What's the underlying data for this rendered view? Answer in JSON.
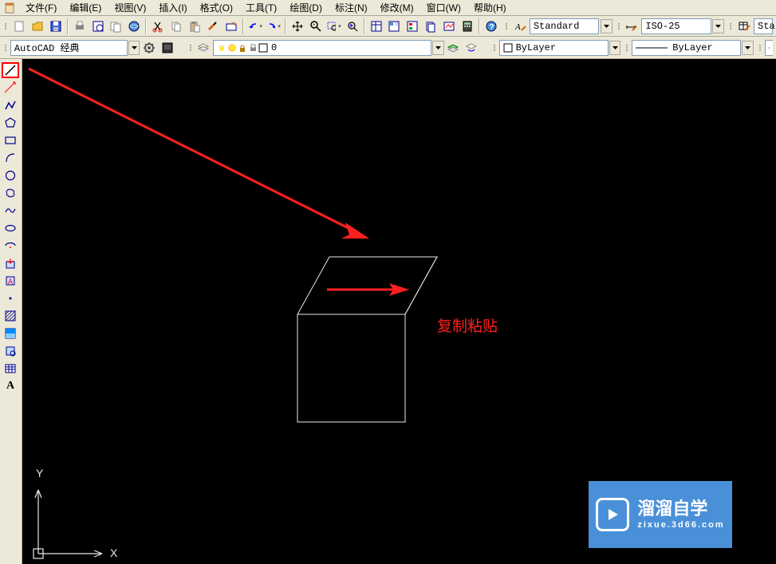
{
  "menu": {
    "items": [
      {
        "label": "文件(F)",
        "key": "F"
      },
      {
        "label": "编辑(E)",
        "key": "E"
      },
      {
        "label": "视图(V)",
        "key": "V"
      },
      {
        "label": "插入(I)",
        "key": "I"
      },
      {
        "label": "格式(O)",
        "key": "O"
      },
      {
        "label": "工具(T)",
        "key": "T"
      },
      {
        "label": "绘图(D)",
        "key": "D"
      },
      {
        "label": "标注(N)",
        "key": "N"
      },
      {
        "label": "修改(M)",
        "key": "M"
      },
      {
        "label": "窗口(W)",
        "key": "W"
      },
      {
        "label": "帮助(H)",
        "key": "H"
      }
    ]
  },
  "toolbar1": {
    "text_style": "Standard",
    "dim_style": "ISO-25",
    "table_style_abbrev": "Sta"
  },
  "toolbar2": {
    "workspace": "AutoCAD 经典",
    "layer_current": "0",
    "properties_color": "ByLayer",
    "linetype": "ByLayer"
  },
  "canvas": {
    "annotation_text": "复制粘贴",
    "axis_y": "Y",
    "axis_x": "X"
  },
  "watermark": {
    "brand": "溜溜自学",
    "url": "zixue.3d66.com"
  },
  "colors": {
    "accent_red": "#ff0000",
    "canvas_bg": "#000000",
    "ui_bg": "#ece9d8",
    "watermark_bg": "#4a90d9"
  },
  "left_tools": [
    "line-tool",
    "construction-line-tool",
    "polyline-tool",
    "polygon-tool",
    "rectangle-tool",
    "arc-tool",
    "circle-tool",
    "revision-cloud-tool",
    "spline-tool",
    "ellipse-tool",
    "ellipse-arc-tool",
    "insert-block-tool",
    "make-block-tool",
    "point-tool",
    "hatch-tool",
    "gradient-tool",
    "region-tool",
    "table-tool",
    "multiline-text-tool"
  ]
}
